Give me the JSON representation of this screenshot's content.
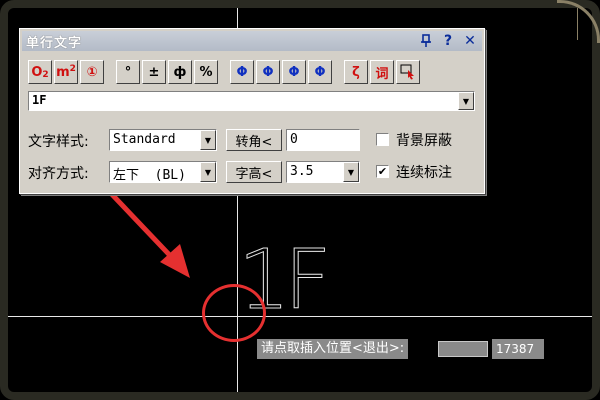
{
  "dialog": {
    "title": "单行文字",
    "title_icons": [
      "pin-icon",
      "help-icon",
      "close-icon"
    ],
    "toolbar": [
      {
        "label": "O₂",
        "icon": "subscript-icon"
      },
      {
        "label": "m²",
        "icon": "superscript-icon"
      },
      {
        "label": "①",
        "icon": "circled-number-icon"
      },
      {
        "label": "°",
        "icon": "degree-icon"
      },
      {
        "label": "±",
        "icon": "plus-minus-icon"
      },
      {
        "label": "ф",
        "icon": "diameter-icon"
      },
      {
        "label": "%",
        "icon": "percent-icon"
      },
      {
        "label": "Φ",
        "icon": "steel-grade-1-icon"
      },
      {
        "label": "Φ",
        "icon": "steel-grade-2-icon"
      },
      {
        "label": "Φ",
        "icon": "steel-grade-3-icon"
      },
      {
        "label": "Φ",
        "icon": "steel-grade-4-icon"
      },
      {
        "label": "ζ",
        "icon": "special-symbol-icon"
      },
      {
        "label": "词",
        "icon": "word-library-icon"
      },
      {
        "label": "",
        "icon": "pick-text-icon"
      }
    ],
    "text_input_value": "1F",
    "style_label": "文字样式:",
    "style_value": "Standard",
    "rotate_button": "转角<",
    "rotate_value": "0",
    "mask_label": "背景屏蔽",
    "mask_checked": false,
    "align_label": "对齐方式:",
    "align_value": "左下  (BL)",
    "height_button": "字高<",
    "height_value": "3.5",
    "continuous_label": "连续标注",
    "continuous_checked": true
  },
  "canvas": {
    "drawn_text": "1F",
    "annotation_color": "#e53030"
  },
  "command_line": {
    "prompt": "请点取插入位置<退出>:",
    "coordinate": "17387"
  }
}
